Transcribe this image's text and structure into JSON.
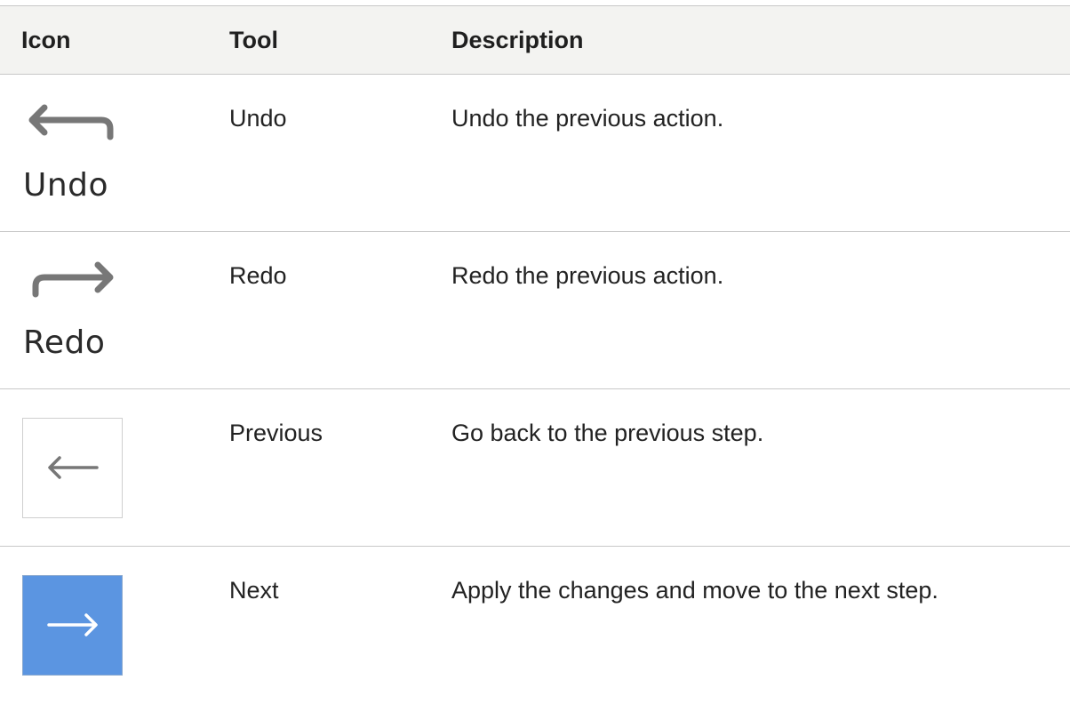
{
  "table": {
    "headers": {
      "icon": "Icon",
      "tool": "Tool",
      "description": "Description"
    },
    "rows": [
      {
        "icon_name": "undo-icon",
        "icon_caption": "Undo",
        "tool": "Undo",
        "description": "Undo the previous action."
      },
      {
        "icon_name": "redo-icon",
        "icon_caption": "Redo",
        "tool": "Redo",
        "description": "Redo the previous action."
      },
      {
        "icon_name": "arrow-left-icon",
        "tool": "Previous",
        "description": "Go back to the previous step."
      },
      {
        "icon_name": "arrow-right-icon",
        "tool": "Next",
        "description": "Apply the changes and move to the next step."
      }
    ]
  },
  "colors": {
    "header_background": "#f3f3f1",
    "row_divider": "#c8c8c8",
    "icon_gray": "#777777",
    "next_button_blue": "#5b95e1"
  }
}
